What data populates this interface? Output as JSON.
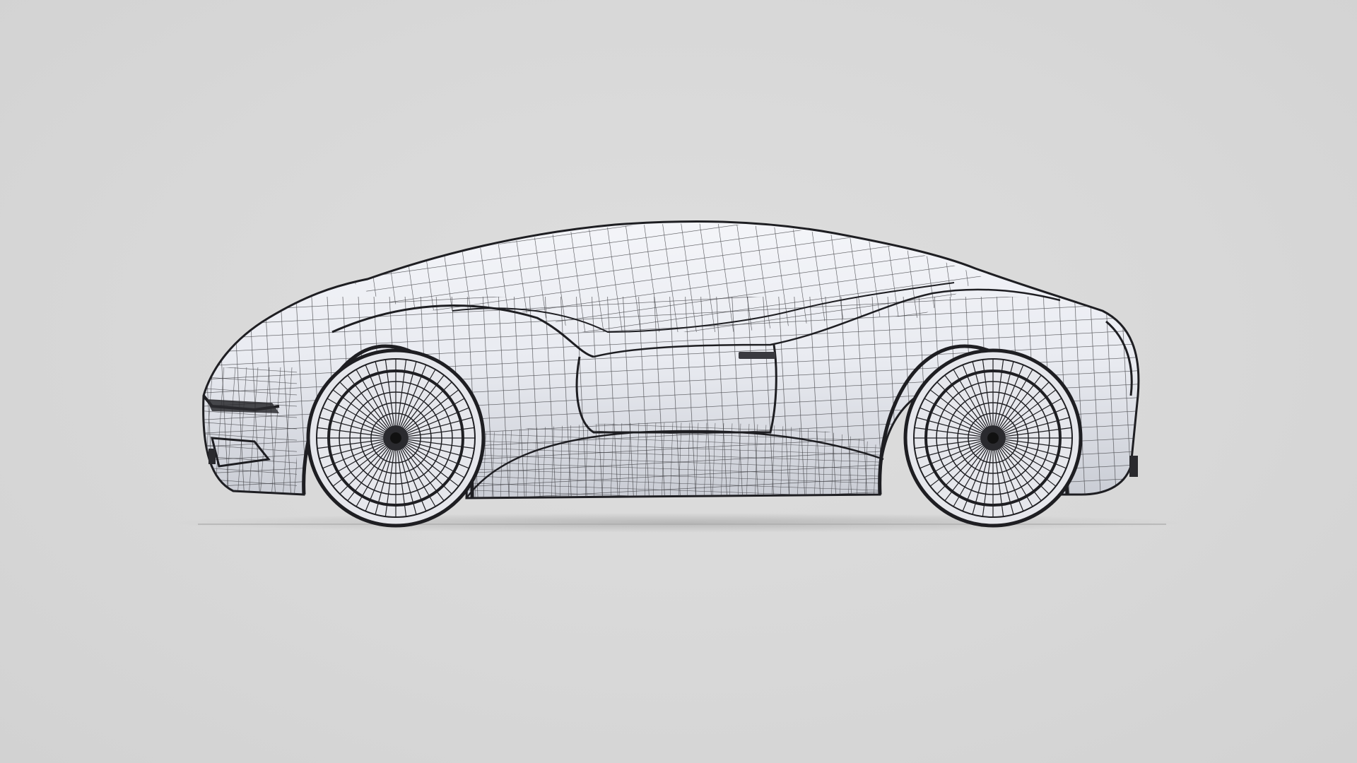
{
  "scene": {
    "subject": "car-wireframe-render",
    "view": "side",
    "background_color": "#d9d9d9",
    "body_color": "#eceef3",
    "wire_color": "#2a2a2e",
    "shadow_color": "#bfbfbf"
  }
}
